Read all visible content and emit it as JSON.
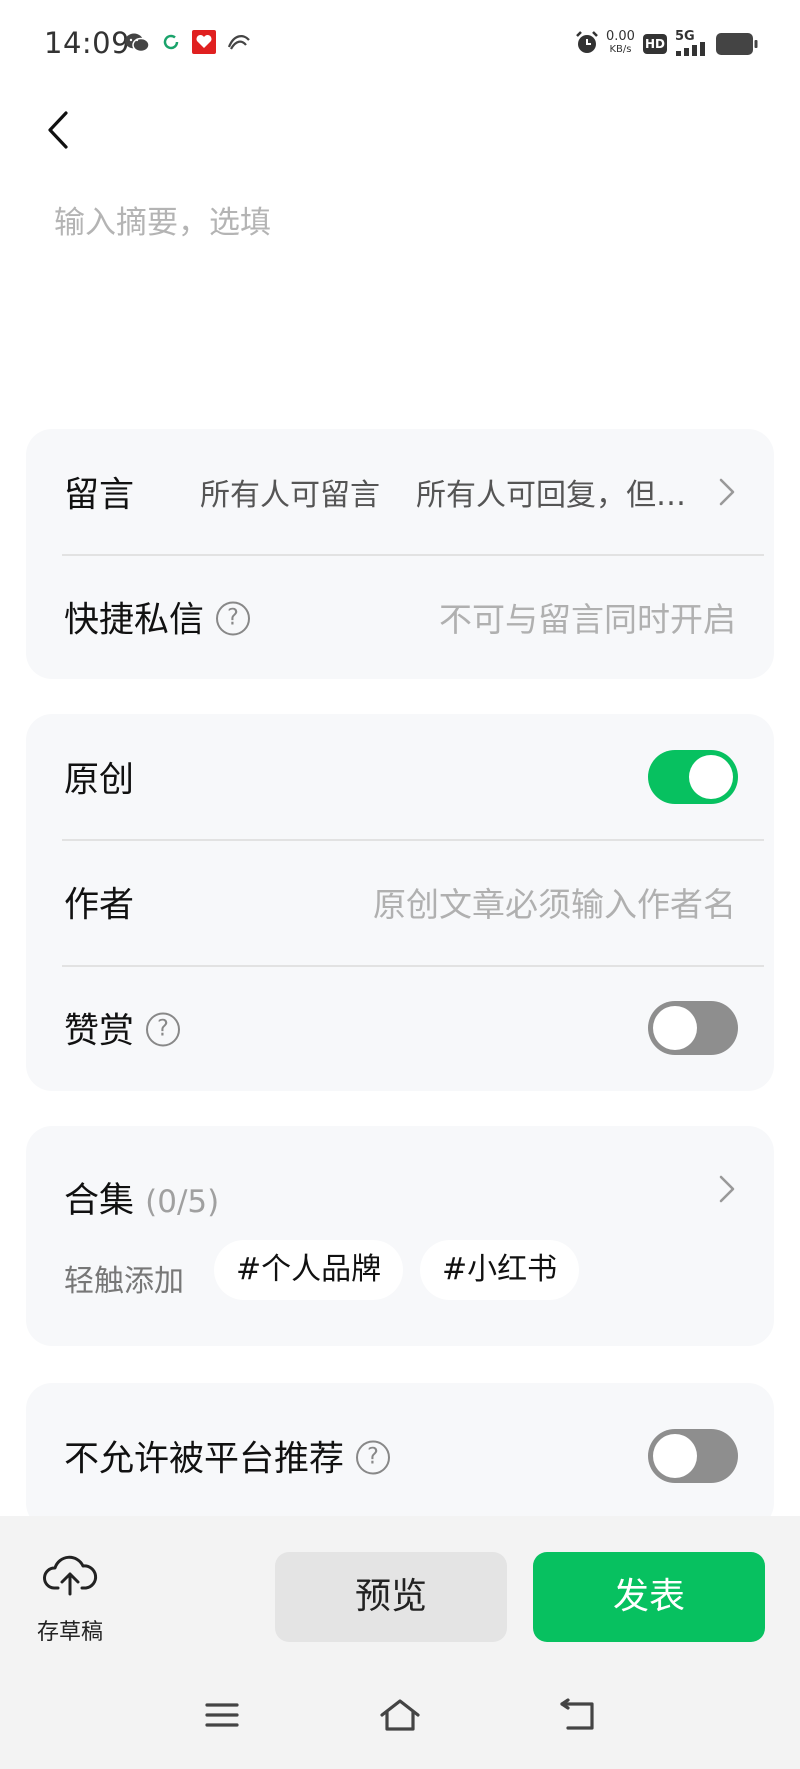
{
  "status_bar": {
    "time": "14:09",
    "net_speed_value": "0.00",
    "net_speed_unit": "KB/s",
    "hd_badge": "HD",
    "network_type": "5G",
    "icons": [
      "wechat-icon",
      "refresh-icon",
      "app-icon",
      "app-icon",
      "alarm-icon",
      "signal-icon",
      "battery-icon"
    ]
  },
  "summary": {
    "placeholder": "输入摘要，选填"
  },
  "comments_card": {
    "comment_label": "留言",
    "comment_value_1": "所有人可留言",
    "comment_value_2": "所有人可回复，但…",
    "dm_label": "快捷私信",
    "dm_value": "不可与留言同时开启"
  },
  "original_card": {
    "original_label": "原创",
    "original_enabled": true,
    "author_label": "作者",
    "author_placeholder": "原创文章必须输入作者名",
    "reward_label": "赞赏",
    "reward_enabled": false
  },
  "collection_card": {
    "label": "合集",
    "count": "(0/5)",
    "tap_hint": "轻触添加",
    "tags": [
      "#个人品牌",
      "#小红书"
    ]
  },
  "recommend_card": {
    "label": "不允许被平台推荐",
    "enabled": false
  },
  "help_glyph": "?",
  "bottom_bar": {
    "draft_label": "存草稿",
    "preview_label": "预览",
    "publish_label": "发表"
  },
  "colors": {
    "accent": "#07c160",
    "card_bg": "#f7f8fa",
    "toggle_off": "#8e8e8e"
  }
}
